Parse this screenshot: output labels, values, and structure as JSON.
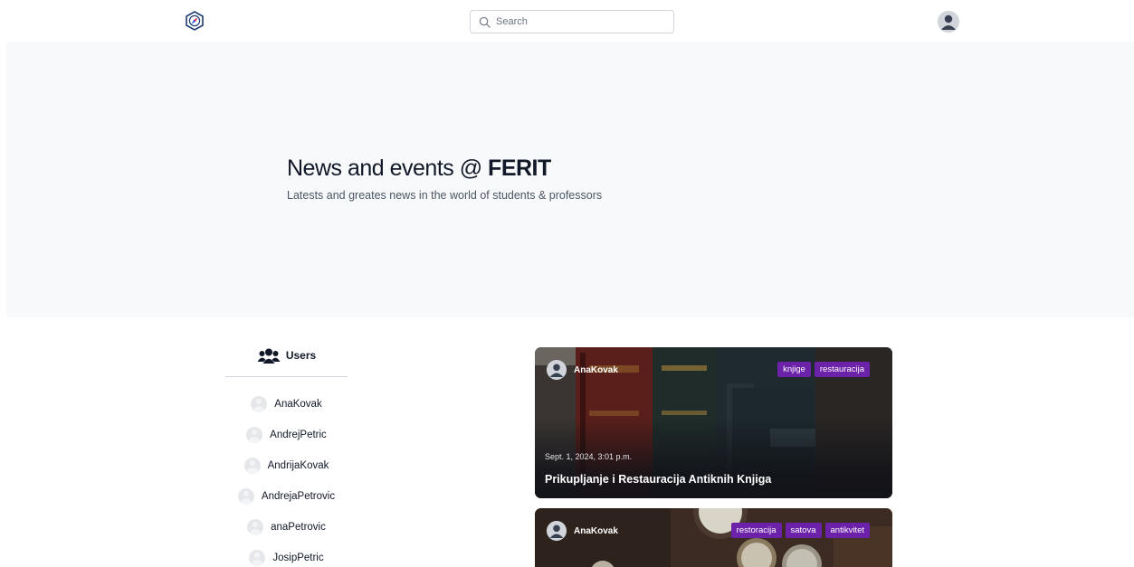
{
  "nav": {
    "logo_icon": "compass-logo-icon",
    "search_placeholder": "Search",
    "search_icon": "search-icon",
    "avatar_icon": "user-avatar-icon"
  },
  "hero": {
    "title_prefix": "News and events @ ",
    "title_brand": "FERIT",
    "subtitle": "Latests and greates news in the world of students & professors"
  },
  "users": {
    "heading": "Users",
    "heading_icon": "users-group-icon",
    "items": [
      "AnaKovak",
      "AndrejPetric",
      "AndrijaKovak",
      "AndrejaPetrovic",
      "anaPetrovic",
      "JosipPetric"
    ]
  },
  "posts": [
    {
      "author": "AnaKovak",
      "tags": [
        "knjige",
        "restauracija"
      ],
      "date": "Sept. 1, 2024, 3:01 p.m.",
      "title": "Prikupljanje i Restauracija Antiknih Knjiga"
    },
    {
      "author": "AnaKovak",
      "tags": [
        "restoracija",
        "satova",
        "antikvitet"
      ]
    }
  ],
  "colors": {
    "tag_bg": "#6b21a8",
    "hero_bg": "#f8f9fb",
    "text_primary": "#111827"
  }
}
